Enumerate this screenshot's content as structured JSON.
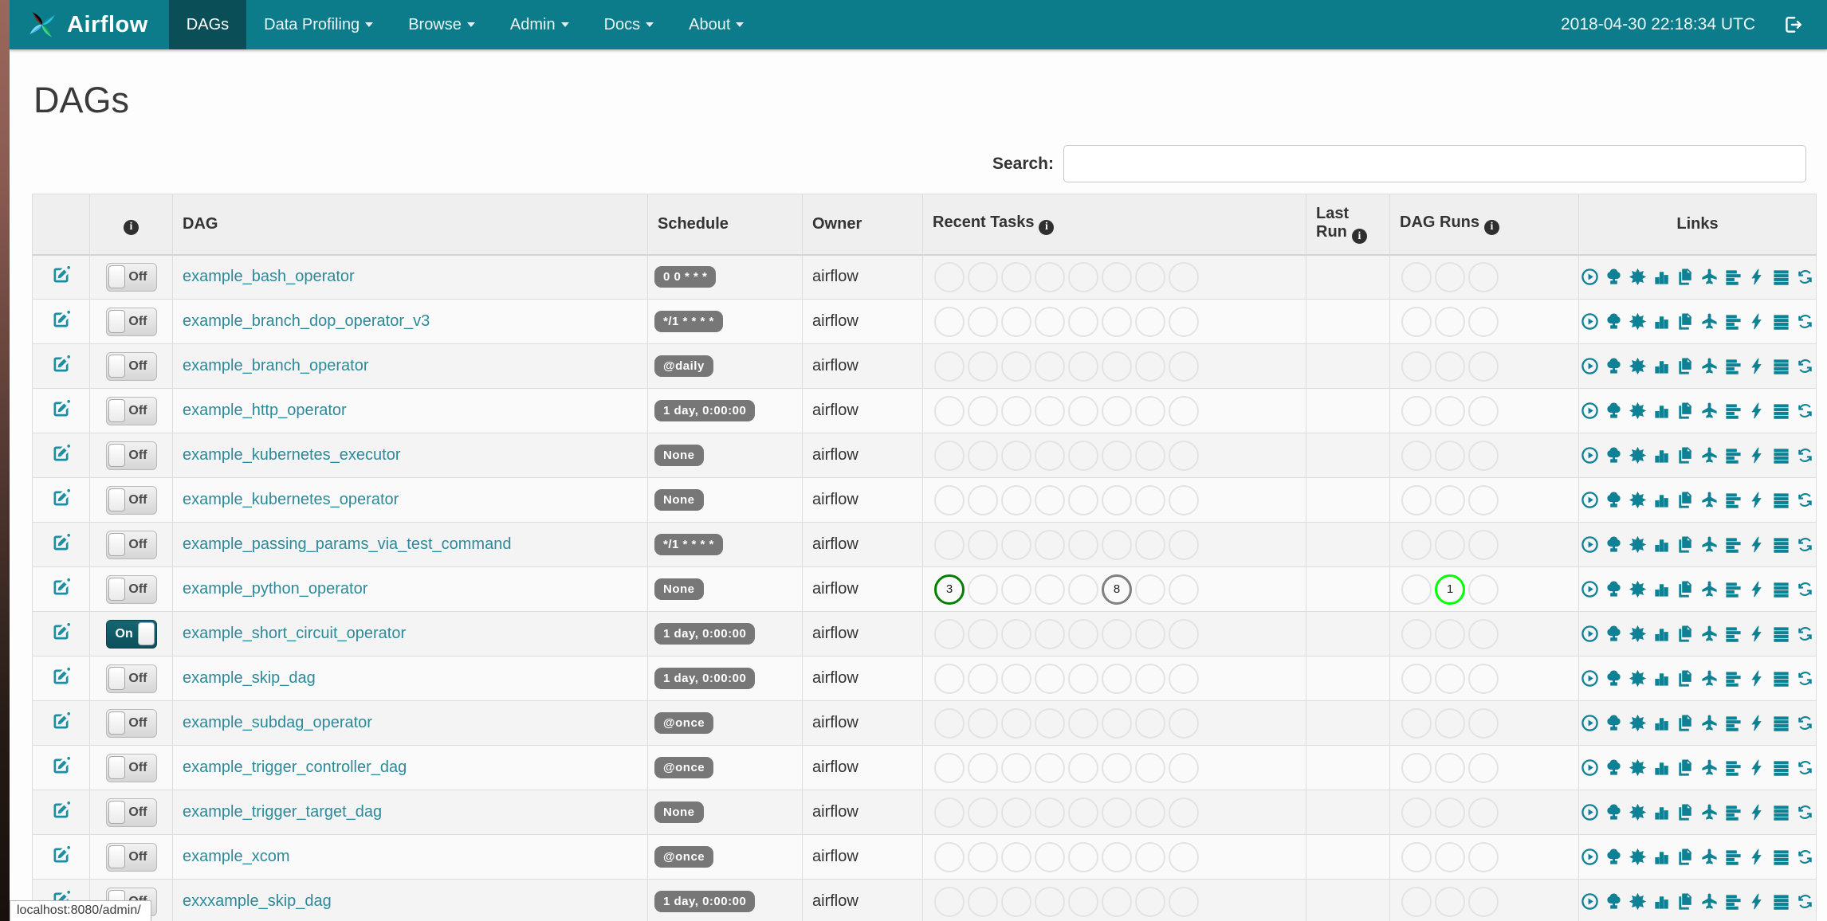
{
  "navbar": {
    "brand": "Airflow",
    "items": [
      {
        "label": "DAGs",
        "active": true,
        "dropdown": false
      },
      {
        "label": "Data Profiling",
        "active": false,
        "dropdown": true
      },
      {
        "label": "Browse",
        "active": false,
        "dropdown": true
      },
      {
        "label": "Admin",
        "active": false,
        "dropdown": true
      },
      {
        "label": "Docs",
        "active": false,
        "dropdown": true
      },
      {
        "label": "About",
        "active": false,
        "dropdown": true
      }
    ],
    "clock": "2018-04-30 22:18:34 UTC"
  },
  "page": {
    "title": "DAGs"
  },
  "search": {
    "label": "Search:",
    "value": ""
  },
  "toggle": {
    "on_label": "On",
    "off_label": "Off"
  },
  "state_colors": {
    "success": "#008000",
    "running": "#00ff00",
    "queued": "#808080",
    "empty": "#e3e3e3"
  },
  "links_icons": [
    "trigger-dag",
    "tree-view",
    "graph-view",
    "task-duration",
    "task-tries",
    "landing-times",
    "gantt-view",
    "code-view",
    "logs",
    "refresh"
  ],
  "table": {
    "headers": {
      "dag": "DAG",
      "schedule": "Schedule",
      "owner": "Owner",
      "recent_tasks": "Recent Tasks",
      "last_run": "Last Run",
      "dag_runs": "DAG Runs",
      "links": "Links"
    },
    "recent_tasks_slots": 8,
    "dag_runs_slots": 3,
    "rows": [
      {
        "dag": "example_bash_operator",
        "schedule": "0 0 * * *",
        "owner": "airflow",
        "enabled": false,
        "last_run": "",
        "recent_tasks": [],
        "dag_runs": []
      },
      {
        "dag": "example_branch_dop_operator_v3",
        "schedule": "*/1 * * * *",
        "owner": "airflow",
        "enabled": false,
        "last_run": "",
        "recent_tasks": [],
        "dag_runs": []
      },
      {
        "dag": "example_branch_operator",
        "schedule": "@daily",
        "owner": "airflow",
        "enabled": false,
        "last_run": "",
        "recent_tasks": [],
        "dag_runs": []
      },
      {
        "dag": "example_http_operator",
        "schedule": "1 day, 0:00:00",
        "owner": "airflow",
        "enabled": false,
        "last_run": "",
        "recent_tasks": [],
        "dag_runs": []
      },
      {
        "dag": "example_kubernetes_executor",
        "schedule": "None",
        "owner": "airflow",
        "enabled": false,
        "last_run": "",
        "recent_tasks": [],
        "dag_runs": []
      },
      {
        "dag": "example_kubernetes_operator",
        "schedule": "None",
        "owner": "airflow",
        "enabled": false,
        "last_run": "",
        "recent_tasks": [],
        "dag_runs": []
      },
      {
        "dag": "example_passing_params_via_test_command",
        "schedule": "*/1 * * * *",
        "owner": "airflow",
        "enabled": false,
        "last_run": "",
        "recent_tasks": [],
        "dag_runs": []
      },
      {
        "dag": "example_python_operator",
        "schedule": "None",
        "owner": "airflow",
        "enabled": false,
        "last_run": "",
        "recent_tasks": [
          {
            "index": 0,
            "count": "3",
            "state": "success"
          },
          {
            "index": 5,
            "count": "8",
            "state": "queued"
          }
        ],
        "dag_runs": [
          {
            "index": 1,
            "count": "1",
            "state": "running"
          }
        ]
      },
      {
        "dag": "example_short_circuit_operator",
        "schedule": "1 day, 0:00:00",
        "owner": "airflow",
        "enabled": true,
        "last_run": "",
        "recent_tasks": [],
        "dag_runs": []
      },
      {
        "dag": "example_skip_dag",
        "schedule": "1 day, 0:00:00",
        "owner": "airflow",
        "enabled": false,
        "last_run": "",
        "recent_tasks": [],
        "dag_runs": []
      },
      {
        "dag": "example_subdag_operator",
        "schedule": "@once",
        "owner": "airflow",
        "enabled": false,
        "last_run": "",
        "recent_tasks": [],
        "dag_runs": []
      },
      {
        "dag": "example_trigger_controller_dag",
        "schedule": "@once",
        "owner": "airflow",
        "enabled": false,
        "last_run": "",
        "recent_tasks": [],
        "dag_runs": []
      },
      {
        "dag": "example_trigger_target_dag",
        "schedule": "None",
        "owner": "airflow",
        "enabled": false,
        "last_run": "",
        "recent_tasks": [],
        "dag_runs": []
      },
      {
        "dag": "example_xcom",
        "schedule": "@once",
        "owner": "airflow",
        "enabled": false,
        "last_run": "",
        "recent_tasks": [],
        "dag_runs": []
      },
      {
        "dag": "exxxample_skip_dag",
        "schedule": "1 day, 0:00:00",
        "owner": "airflow",
        "enabled": false,
        "last_run": "",
        "recent_tasks": [],
        "dag_runs": []
      }
    ]
  },
  "status_bar": "localhost:8080/admin/"
}
